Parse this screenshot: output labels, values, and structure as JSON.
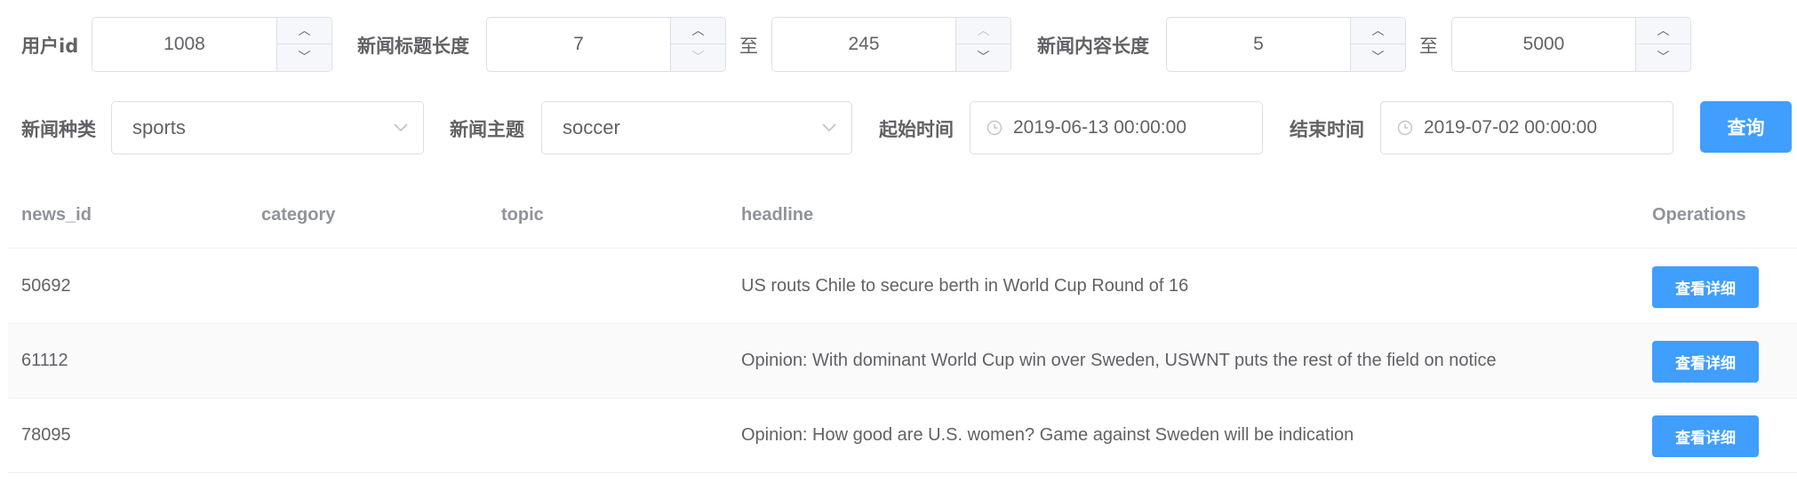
{
  "filters": {
    "user_id": {
      "label": "用户id",
      "value": "1008"
    },
    "title_length": {
      "label": "新闻标题长度",
      "min": "7",
      "to": "至",
      "max": "245"
    },
    "content_length": {
      "label": "新闻内容长度",
      "min": "5",
      "to": "至",
      "max": "5000"
    },
    "category": {
      "label": "新闻种类",
      "value": "sports"
    },
    "topic": {
      "label": "新闻主题",
      "value": "soccer"
    },
    "start_time": {
      "label": "起始时间",
      "value": "2019-06-13 00:00:00"
    },
    "end_time": {
      "label": "结束时间",
      "value": "2019-07-02 00:00:00"
    },
    "query_button": "查询"
  },
  "table": {
    "columns": [
      "news_id",
      "category",
      "topic",
      "headline",
      "Operations"
    ],
    "rows": [
      {
        "news_id": "50692",
        "category": "",
        "topic": "",
        "headline": "US routs Chile to secure berth in World Cup Round of 16",
        "action": "查看详细"
      },
      {
        "news_id": "61112",
        "category": "",
        "topic": "",
        "headline": "Opinion: With dominant World Cup win over Sweden, USWNT puts the rest of the field on notice",
        "action": "查看详细"
      },
      {
        "news_id": "78095",
        "category": "",
        "topic": "",
        "headline": "Opinion: How good are U.S. women? Game against Sweden will be indication",
        "action": "查看详细"
      }
    ]
  },
  "colors": {
    "primary": "#409eff",
    "border": "#dcdfe6",
    "text": "#606266",
    "header_text": "#909399",
    "stripe": "#fafafa"
  },
  "icons": {
    "increase": "chevron-up-icon",
    "decrease": "chevron-down-icon",
    "select": "chevron-down-icon",
    "date": "clock-icon"
  }
}
